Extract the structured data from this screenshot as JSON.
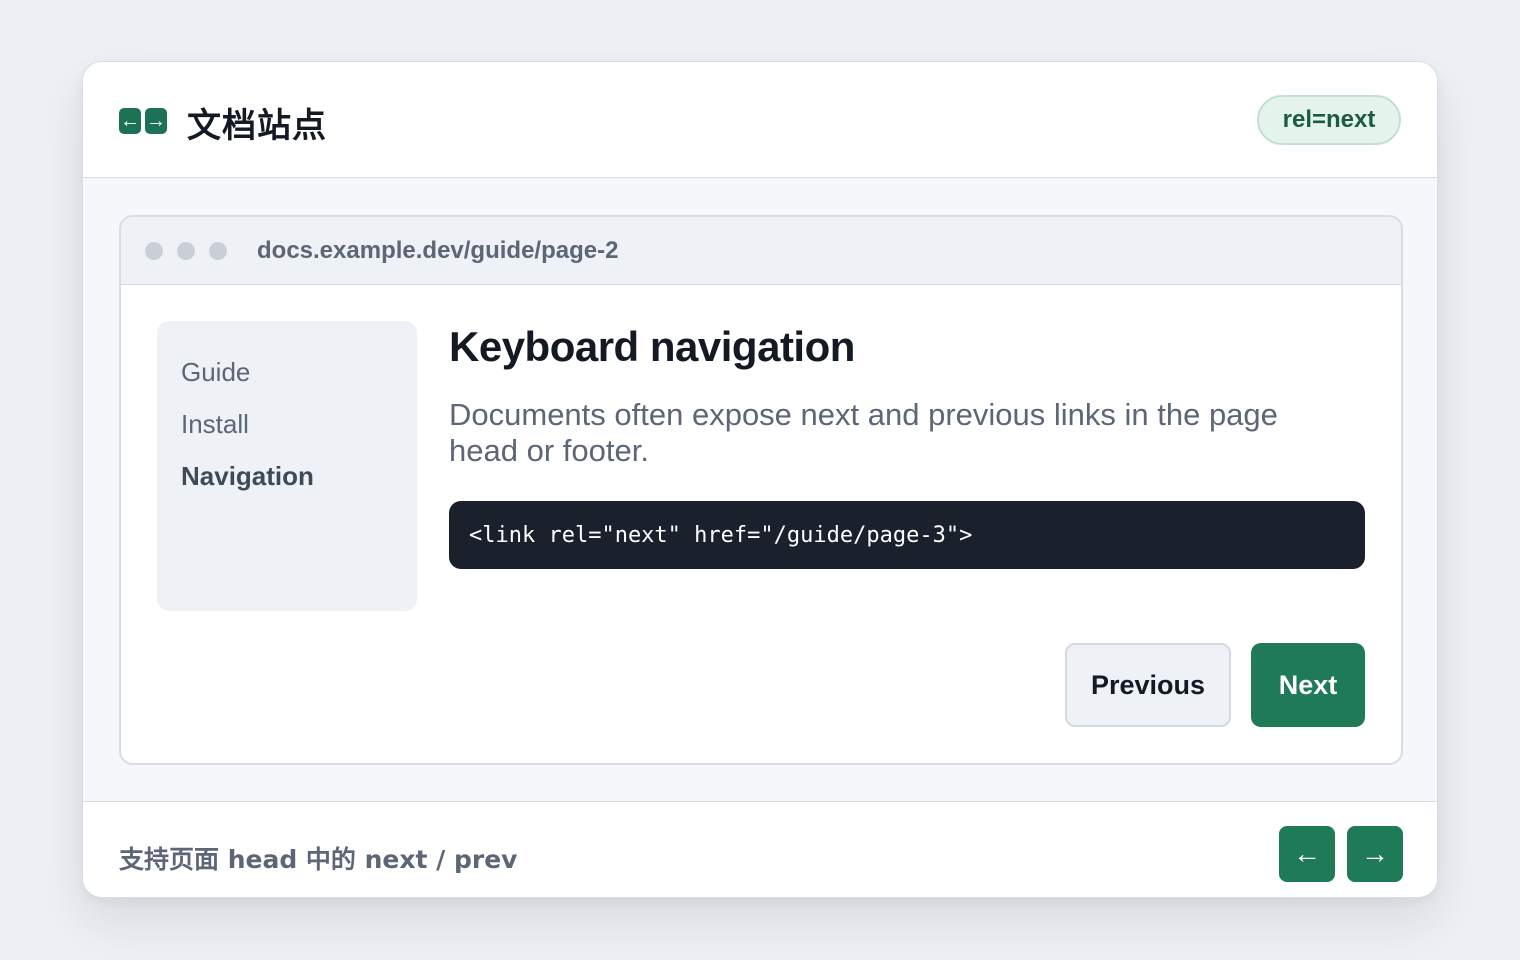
{
  "header": {
    "site_title": "文档站点",
    "badge": "rel=next",
    "logo_left_glyph": "←",
    "logo_right_glyph": "→"
  },
  "browser": {
    "url": "docs.example.dev/guide/page-2"
  },
  "sidebar": {
    "items": [
      {
        "label": "Guide",
        "active": false
      },
      {
        "label": "Install",
        "active": false
      },
      {
        "label": "Navigation",
        "active": true
      }
    ]
  },
  "content": {
    "title": "Keyboard navigation",
    "description": "Documents often expose next and previous links in the page head or footer.",
    "code": "<link rel=\"next\" href=\"/guide/page-3\">",
    "previous_label": "Previous",
    "next_label": "Next"
  },
  "footer": {
    "text": "支持页面 head 中的 next / prev",
    "prev_glyph": "←",
    "next_glyph": "→"
  },
  "colors": {
    "accent": "#1f7a58",
    "code_bg": "#1a202c",
    "badge_bg": "#e4f3ec"
  },
  "icons": {
    "logo": "arrows-left-right-icon",
    "footer_prev": "arrow-left-icon",
    "footer_next": "arrow-right-icon"
  }
}
